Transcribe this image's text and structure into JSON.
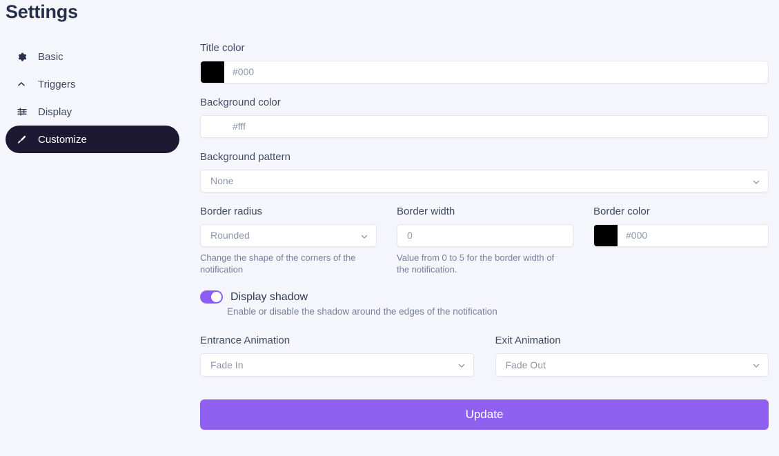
{
  "page": {
    "title": "Settings",
    "background_color": "#f5f6fc"
  },
  "sidebar": {
    "items": [
      {
        "label": "Basic",
        "icon": "gear-icon",
        "active": false
      },
      {
        "label": "Triggers",
        "icon": "chevron-up-icon",
        "active": false
      },
      {
        "label": "Display",
        "icon": "sliders-icon",
        "active": false
      },
      {
        "label": "Customize",
        "icon": "paintbrush-icon",
        "active": true
      }
    ],
    "active_background": "#1d1933"
  },
  "form": {
    "title_color": {
      "label": "Title color",
      "value": "#000",
      "swatch": "#000000"
    },
    "background_color": {
      "label": "Background color",
      "value": "#fff",
      "swatch": "#ffffff"
    },
    "background_pattern": {
      "label": "Background pattern",
      "value": "None"
    },
    "border_radius": {
      "label": "Border radius",
      "value": "Rounded",
      "hint": "Change the shape of the corners of the notification"
    },
    "border_width": {
      "label": "Border width",
      "value": "0",
      "hint": "Value from 0 to 5 for the border width of the notification."
    },
    "border_color": {
      "label": "Border color",
      "value": "#000",
      "swatch": "#000000"
    },
    "display_shadow": {
      "label": "Display shadow",
      "hint": "Enable or disable the shadow around the edges of the notification",
      "enabled": "on",
      "accent_color": "#8b5cf6"
    },
    "entrance_animation": {
      "label": "Entrance Animation",
      "value": "Fade In"
    },
    "exit_animation": {
      "label": "Exit Animation",
      "value": "Fade Out"
    },
    "submit": {
      "label": "Update",
      "color": "#9061f0"
    }
  }
}
